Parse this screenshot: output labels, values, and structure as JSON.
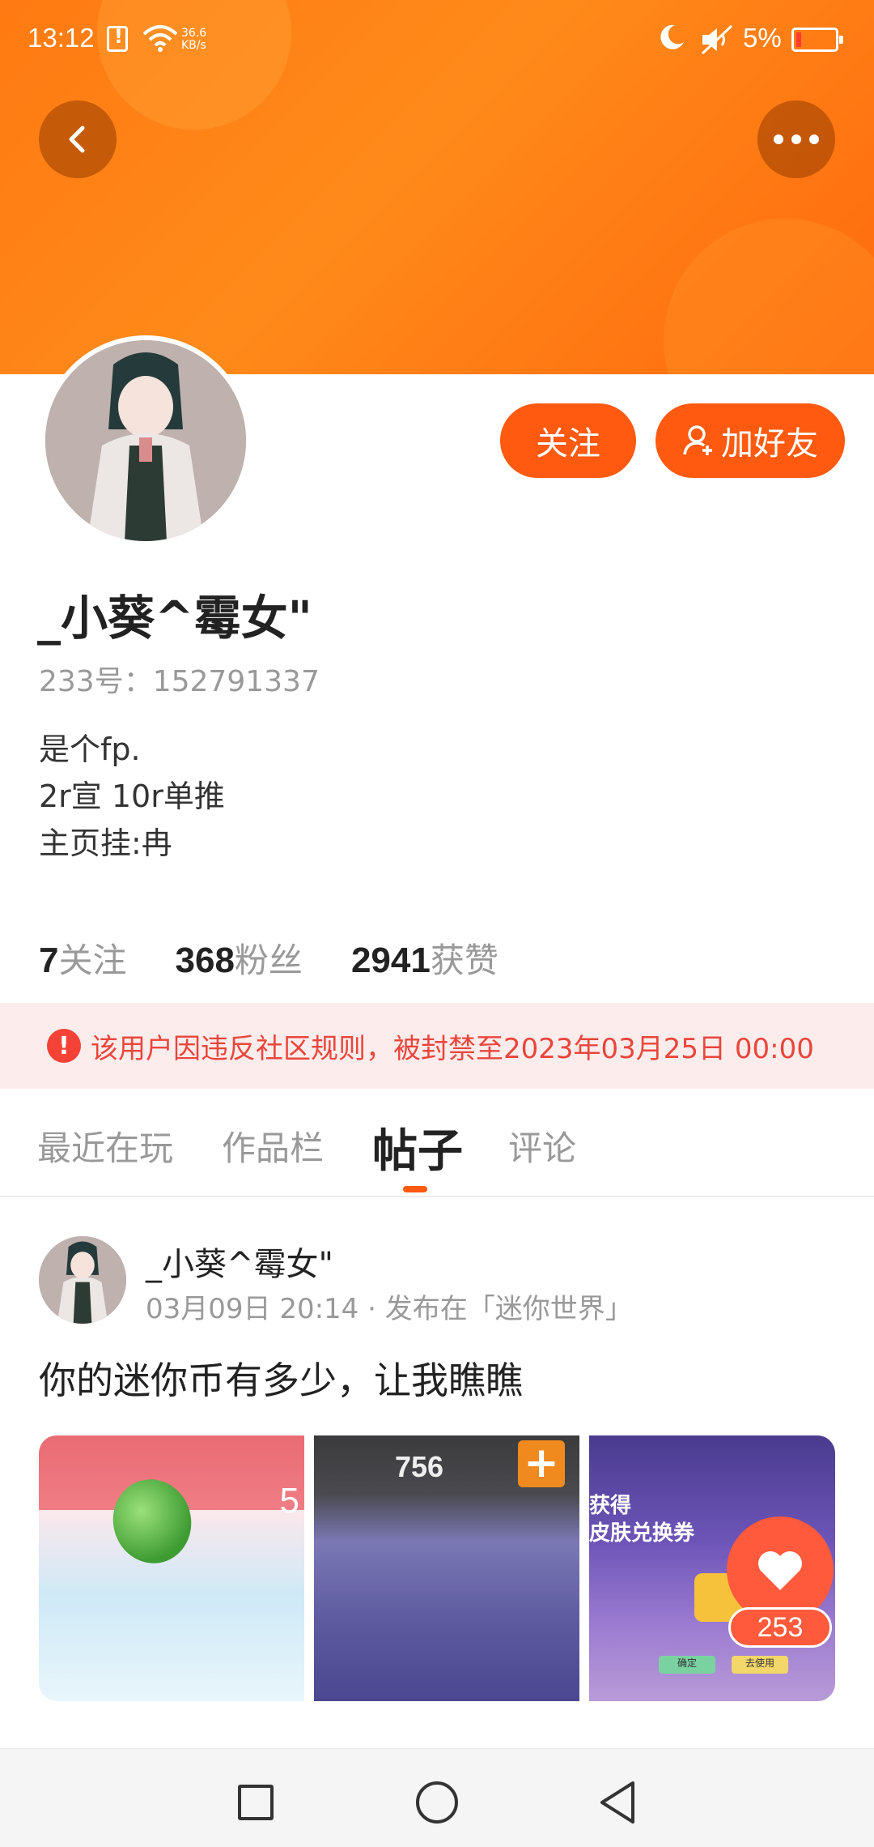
{
  "status_bar": {
    "time": "13:12",
    "speed_value": "36.6",
    "speed_unit": "KB/s",
    "battery": "5%"
  },
  "profile": {
    "username": "_小葵^霉女\"",
    "id_label": "233号：152791337",
    "bio": [
      "是个fp.",
      "2r宣 10r单推",
      "主页挂:冉"
    ],
    "follow_button": "关注",
    "add_friend_button": "加好友",
    "stats": [
      {
        "num": "7",
        "label": "关注"
      },
      {
        "num": "368",
        "label": "粉丝"
      },
      {
        "num": "2941",
        "label": "获赞"
      }
    ]
  },
  "ban_notice": "该用户因违反社区规则，被封禁至2023年03月25日 00:00",
  "tabs": [
    "最近在玩",
    "作品栏",
    "帖子",
    "评论"
  ],
  "active_tab": "帖子",
  "post": {
    "author": "_小葵^霉女\"",
    "meta": "03月09日 20:14 · 发布在「迷你世界」",
    "text": "你的迷你币有多少，让我瞧瞧",
    "image1_number": "5",
    "image2_coins": "756",
    "image3_line1": "获得",
    "image3_line2": "皮肤兑换券",
    "image3_btn1": "确定",
    "image3_btn2": "去使用",
    "like_count": "253"
  },
  "colors": {
    "accent": "#ff5a10",
    "banner": "#ff7a12",
    "ban_bg": "#fdecec",
    "ban_text": "#e9463c"
  }
}
